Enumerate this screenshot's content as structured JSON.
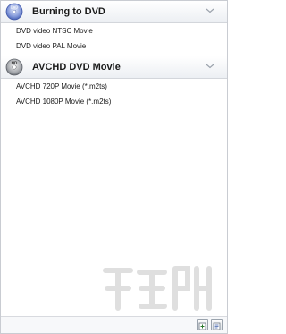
{
  "categories": [
    {
      "title": "Burning to DVD",
      "icon": "dvd-disc-icon",
      "items": [
        {
          "label": "DVD video NTSC Movie"
        },
        {
          "label": "DVD video PAL Movie"
        }
      ]
    },
    {
      "title": "AVCHD DVD Movie",
      "icon": "avchd-disc-icon",
      "items": [
        {
          "label": "AVCHD 720P Movie (*.m2ts)"
        },
        {
          "label": "AVCHD 1080P Movie (*.m2ts)"
        }
      ]
    }
  ],
  "icons": {
    "dvd_label": "DVD",
    "hd_label": "HD"
  },
  "colors": {
    "header_gradient_top": "#ffffff",
    "header_gradient_bottom": "#eceff3",
    "border": "#c9ccd2",
    "disc_blue": "#5a74c4"
  }
}
